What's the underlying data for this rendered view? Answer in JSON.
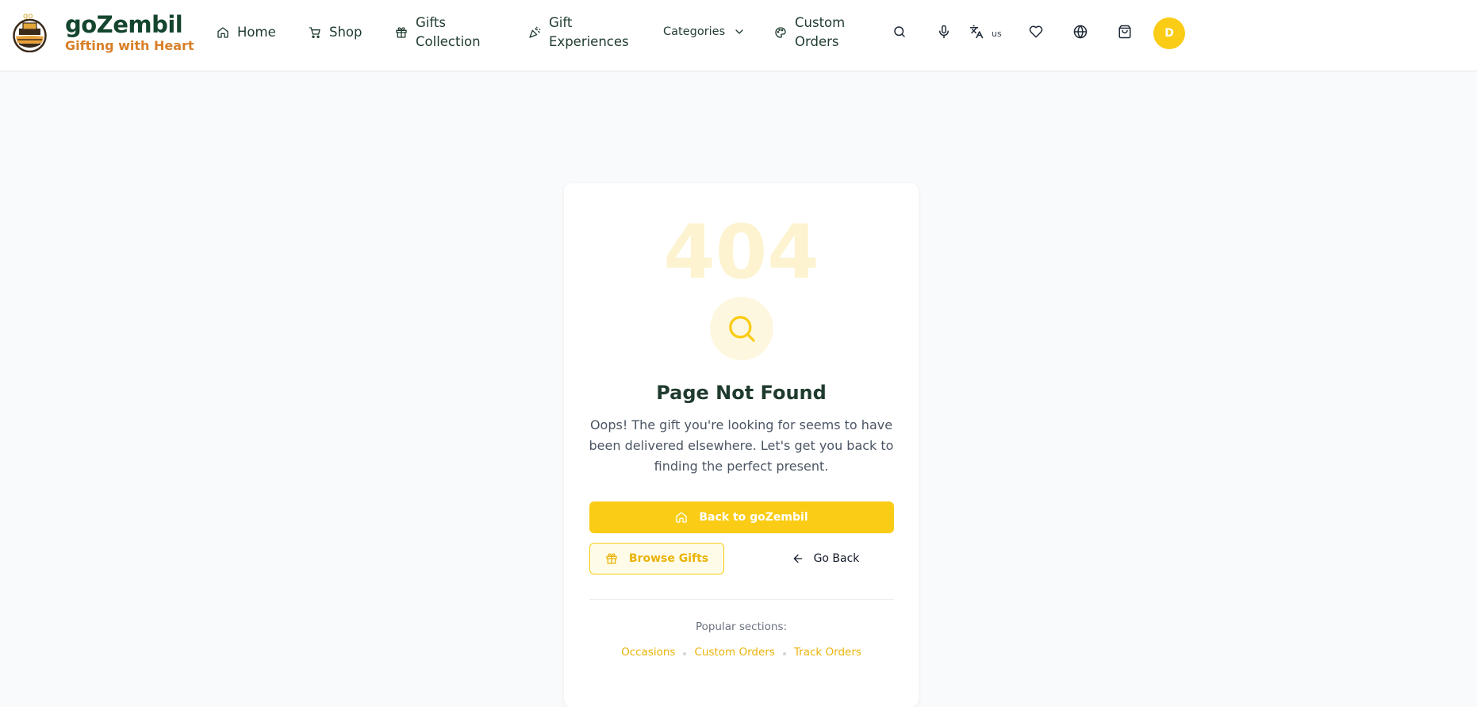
{
  "brand": {
    "logo_text": "go",
    "name": "goZembil",
    "tagline": "Gifting with Heart"
  },
  "nav": {
    "home": "Home",
    "shop": "Shop",
    "gifts_line1": "Gifts",
    "gifts_line2": "Collection",
    "exp_line1": "Gift",
    "exp_line2": "Experiences",
    "categories": "Categories",
    "custom_line1": "Custom",
    "custom_line2": "Orders"
  },
  "header_actions": {
    "language_code": "us",
    "avatar_initial": "D",
    "icons": [
      "search-icon",
      "microphone-icon",
      "translate-icon",
      "heart-icon",
      "globe-icon",
      "shopping-bag-icon"
    ]
  },
  "error": {
    "code": "404",
    "title": "Page Not Found",
    "message": "Oops! The gift you're looking for seems to have been delivered elsewhere. Let's get you back to finding the perfect present.",
    "primary_button": "Back to goZembil",
    "browse_button": "Browse Gifts",
    "back_button": "Go Back",
    "popular_label": "Popular sections:",
    "popular_links": [
      "Occasions",
      "Custom Orders",
      "Track Orders"
    ]
  },
  "colors": {
    "accent": "#facc15",
    "brand_green": "#14452f",
    "brand_orange": "#d97f28",
    "background": "#f8fafc"
  }
}
